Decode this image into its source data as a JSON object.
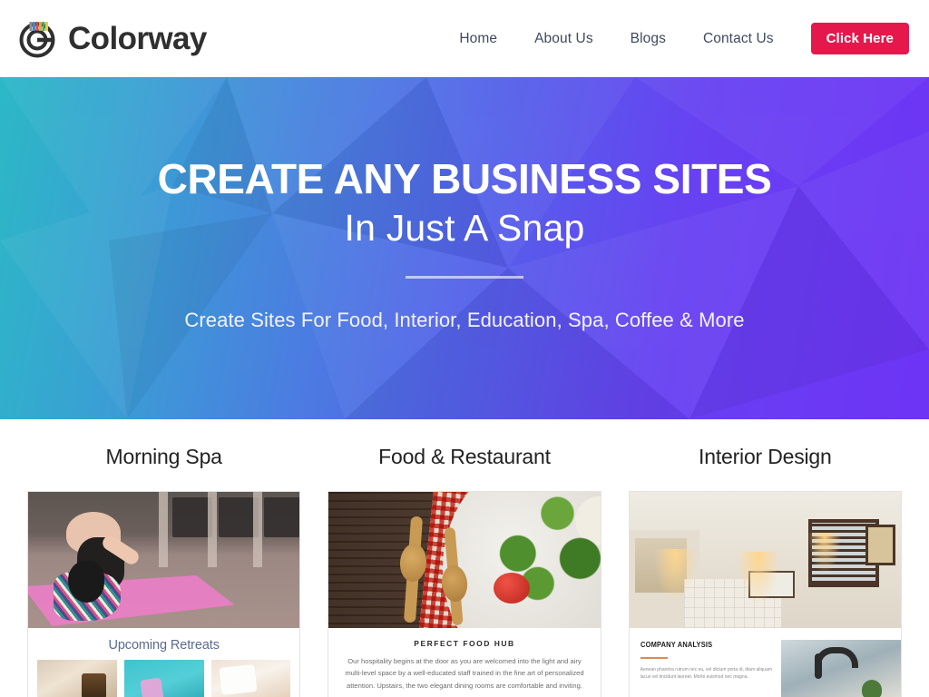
{
  "header": {
    "brand_name": "Colorway",
    "logo_icon": "colorway-circle-logo",
    "nav": [
      {
        "label": "Home"
      },
      {
        "label": "About Us"
      },
      {
        "label": "Blogs"
      },
      {
        "label": "Contact Us"
      }
    ],
    "cta": {
      "label": "Click Here",
      "color": "#e5184c"
    }
  },
  "hero": {
    "title": "CREATE ANY BUSINESS SITES",
    "subtitle": "In Just A Snap",
    "tagline": "Create Sites For Food, Interior, Education, Spa, Coffee & More",
    "gradient_from": "#2cb8c6",
    "gradient_to": "#6e33f5"
  },
  "cards": [
    {
      "title": "Morning Spa",
      "preview": {
        "caption": "Upcoming Retreats",
        "caption_color": "#5a6b91",
        "thumbs": [
          "spa-candle-thumb",
          "spa-bath-salts-thumb",
          "spa-towels-thumb"
        ]
      }
    },
    {
      "title": "Food & Restaurant",
      "preview": {
        "heading": "PERFECT FOOD HUB",
        "body": "Our hospitality begins at the door as you are welcomed into the light and airy multi-level space by a well-educated staff trained in the fine art of personalized attention. Upstairs, the two elegant dining rooms are comfortable and inviting."
      }
    },
    {
      "title": "Interior Design",
      "preview": {
        "heading": "COMPANY ANALYSIS",
        "rule_color": "#d98b52",
        "body": "Aenean pharetra rutrum nec eu, vel dictum porta id, diam aliquam lacus vel tincidunt laoreet. Morbi euismod nec magna."
      }
    }
  ]
}
